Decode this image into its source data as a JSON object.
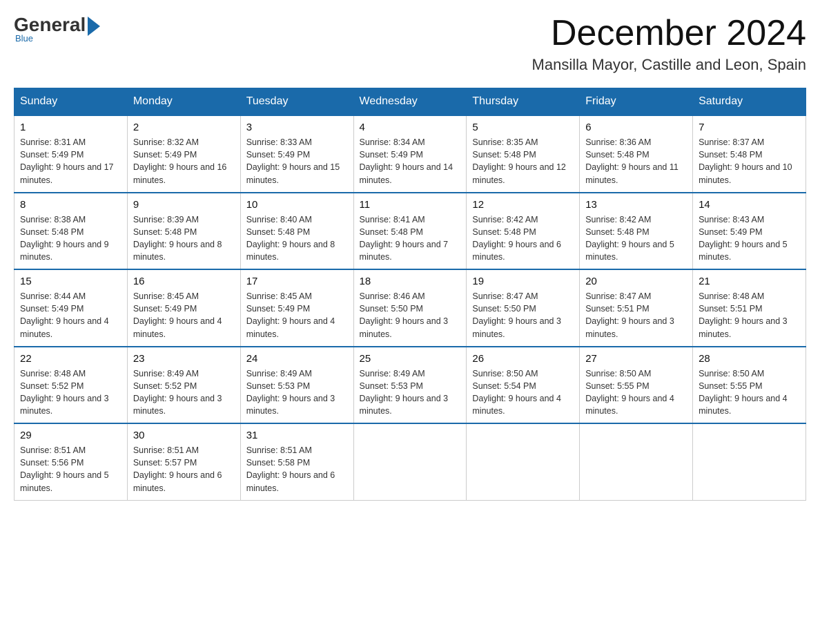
{
  "logo": {
    "general": "General",
    "blue": "Blue",
    "underline": "Blue"
  },
  "title": {
    "month_year": "December 2024",
    "location": "Mansilla Mayor, Castille and Leon, Spain"
  },
  "weekdays": [
    "Sunday",
    "Monday",
    "Tuesday",
    "Wednesday",
    "Thursday",
    "Friday",
    "Saturday"
  ],
  "weeks": [
    [
      {
        "day": "1",
        "sunrise": "Sunrise: 8:31 AM",
        "sunset": "Sunset: 5:49 PM",
        "daylight": "Daylight: 9 hours and 17 minutes."
      },
      {
        "day": "2",
        "sunrise": "Sunrise: 8:32 AM",
        "sunset": "Sunset: 5:49 PM",
        "daylight": "Daylight: 9 hours and 16 minutes."
      },
      {
        "day": "3",
        "sunrise": "Sunrise: 8:33 AM",
        "sunset": "Sunset: 5:49 PM",
        "daylight": "Daylight: 9 hours and 15 minutes."
      },
      {
        "day": "4",
        "sunrise": "Sunrise: 8:34 AM",
        "sunset": "Sunset: 5:49 PM",
        "daylight": "Daylight: 9 hours and 14 minutes."
      },
      {
        "day": "5",
        "sunrise": "Sunrise: 8:35 AM",
        "sunset": "Sunset: 5:48 PM",
        "daylight": "Daylight: 9 hours and 12 minutes."
      },
      {
        "day": "6",
        "sunrise": "Sunrise: 8:36 AM",
        "sunset": "Sunset: 5:48 PM",
        "daylight": "Daylight: 9 hours and 11 minutes."
      },
      {
        "day": "7",
        "sunrise": "Sunrise: 8:37 AM",
        "sunset": "Sunset: 5:48 PM",
        "daylight": "Daylight: 9 hours and 10 minutes."
      }
    ],
    [
      {
        "day": "8",
        "sunrise": "Sunrise: 8:38 AM",
        "sunset": "Sunset: 5:48 PM",
        "daylight": "Daylight: 9 hours and 9 minutes."
      },
      {
        "day": "9",
        "sunrise": "Sunrise: 8:39 AM",
        "sunset": "Sunset: 5:48 PM",
        "daylight": "Daylight: 9 hours and 8 minutes."
      },
      {
        "day": "10",
        "sunrise": "Sunrise: 8:40 AM",
        "sunset": "Sunset: 5:48 PM",
        "daylight": "Daylight: 9 hours and 8 minutes."
      },
      {
        "day": "11",
        "sunrise": "Sunrise: 8:41 AM",
        "sunset": "Sunset: 5:48 PM",
        "daylight": "Daylight: 9 hours and 7 minutes."
      },
      {
        "day": "12",
        "sunrise": "Sunrise: 8:42 AM",
        "sunset": "Sunset: 5:48 PM",
        "daylight": "Daylight: 9 hours and 6 minutes."
      },
      {
        "day": "13",
        "sunrise": "Sunrise: 8:42 AM",
        "sunset": "Sunset: 5:48 PM",
        "daylight": "Daylight: 9 hours and 5 minutes."
      },
      {
        "day": "14",
        "sunrise": "Sunrise: 8:43 AM",
        "sunset": "Sunset: 5:49 PM",
        "daylight": "Daylight: 9 hours and 5 minutes."
      }
    ],
    [
      {
        "day": "15",
        "sunrise": "Sunrise: 8:44 AM",
        "sunset": "Sunset: 5:49 PM",
        "daylight": "Daylight: 9 hours and 4 minutes."
      },
      {
        "day": "16",
        "sunrise": "Sunrise: 8:45 AM",
        "sunset": "Sunset: 5:49 PM",
        "daylight": "Daylight: 9 hours and 4 minutes."
      },
      {
        "day": "17",
        "sunrise": "Sunrise: 8:45 AM",
        "sunset": "Sunset: 5:49 PM",
        "daylight": "Daylight: 9 hours and 4 minutes."
      },
      {
        "day": "18",
        "sunrise": "Sunrise: 8:46 AM",
        "sunset": "Sunset: 5:50 PM",
        "daylight": "Daylight: 9 hours and 3 minutes."
      },
      {
        "day": "19",
        "sunrise": "Sunrise: 8:47 AM",
        "sunset": "Sunset: 5:50 PM",
        "daylight": "Daylight: 9 hours and 3 minutes."
      },
      {
        "day": "20",
        "sunrise": "Sunrise: 8:47 AM",
        "sunset": "Sunset: 5:51 PM",
        "daylight": "Daylight: 9 hours and 3 minutes."
      },
      {
        "day": "21",
        "sunrise": "Sunrise: 8:48 AM",
        "sunset": "Sunset: 5:51 PM",
        "daylight": "Daylight: 9 hours and 3 minutes."
      }
    ],
    [
      {
        "day": "22",
        "sunrise": "Sunrise: 8:48 AM",
        "sunset": "Sunset: 5:52 PM",
        "daylight": "Daylight: 9 hours and 3 minutes."
      },
      {
        "day": "23",
        "sunrise": "Sunrise: 8:49 AM",
        "sunset": "Sunset: 5:52 PM",
        "daylight": "Daylight: 9 hours and 3 minutes."
      },
      {
        "day": "24",
        "sunrise": "Sunrise: 8:49 AM",
        "sunset": "Sunset: 5:53 PM",
        "daylight": "Daylight: 9 hours and 3 minutes."
      },
      {
        "day": "25",
        "sunrise": "Sunrise: 8:49 AM",
        "sunset": "Sunset: 5:53 PM",
        "daylight": "Daylight: 9 hours and 3 minutes."
      },
      {
        "day": "26",
        "sunrise": "Sunrise: 8:50 AM",
        "sunset": "Sunset: 5:54 PM",
        "daylight": "Daylight: 9 hours and 4 minutes."
      },
      {
        "day": "27",
        "sunrise": "Sunrise: 8:50 AM",
        "sunset": "Sunset: 5:55 PM",
        "daylight": "Daylight: 9 hours and 4 minutes."
      },
      {
        "day": "28",
        "sunrise": "Sunrise: 8:50 AM",
        "sunset": "Sunset: 5:55 PM",
        "daylight": "Daylight: 9 hours and 4 minutes."
      }
    ],
    [
      {
        "day": "29",
        "sunrise": "Sunrise: 8:51 AM",
        "sunset": "Sunset: 5:56 PM",
        "daylight": "Daylight: 9 hours and 5 minutes."
      },
      {
        "day": "30",
        "sunrise": "Sunrise: 8:51 AM",
        "sunset": "Sunset: 5:57 PM",
        "daylight": "Daylight: 9 hours and 6 minutes."
      },
      {
        "day": "31",
        "sunrise": "Sunrise: 8:51 AM",
        "sunset": "Sunset: 5:58 PM",
        "daylight": "Daylight: 9 hours and 6 minutes."
      },
      null,
      null,
      null,
      null
    ]
  ]
}
